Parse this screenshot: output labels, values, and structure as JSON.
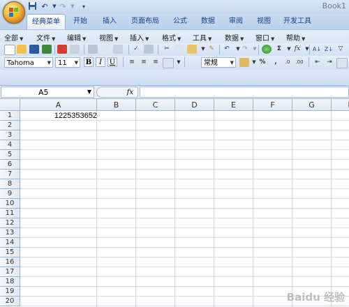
{
  "title_bar": {
    "doc_title": "Book1"
  },
  "ribbon_tabs": [
    "经典菜单",
    "开始",
    "插入",
    "页面布局",
    "公式",
    "数据",
    "审阅",
    "视图",
    "开发工具"
  ],
  "menu": [
    "全部",
    "文件",
    "编辑",
    "视图",
    "插入",
    "格式",
    "工具",
    "数据",
    "窗口",
    "帮助"
  ],
  "toolbar": {
    "font_name": "Tahoma",
    "font_size": "11",
    "bold": "B",
    "italic": "I",
    "underline": "U",
    "number_format": "常规",
    "percent": "%",
    "comma": ",",
    "sigma": "Σ",
    "fx_small": "fx"
  },
  "formula_bar": {
    "name_box": "A5",
    "fx_label": "fx",
    "formula": ""
  },
  "sheet": {
    "columns": [
      "A",
      "B",
      "C",
      "D",
      "E",
      "F",
      "G",
      "H"
    ],
    "rows": [
      "1",
      "2",
      "3",
      "4",
      "5",
      "6",
      "7",
      "8",
      "9",
      "10",
      "11",
      "12",
      "13",
      "14",
      "15",
      "16",
      "17",
      "18",
      "19",
      "20"
    ],
    "cells": {
      "A1": "1225353652"
    }
  },
  "watermark": "Baidu 经验",
  "colors": {
    "ribbon_blue": "#c9daf0",
    "tab_text": "#15428b",
    "grid_line": "#d4dce8",
    "header_border": "#9eb6ce"
  }
}
